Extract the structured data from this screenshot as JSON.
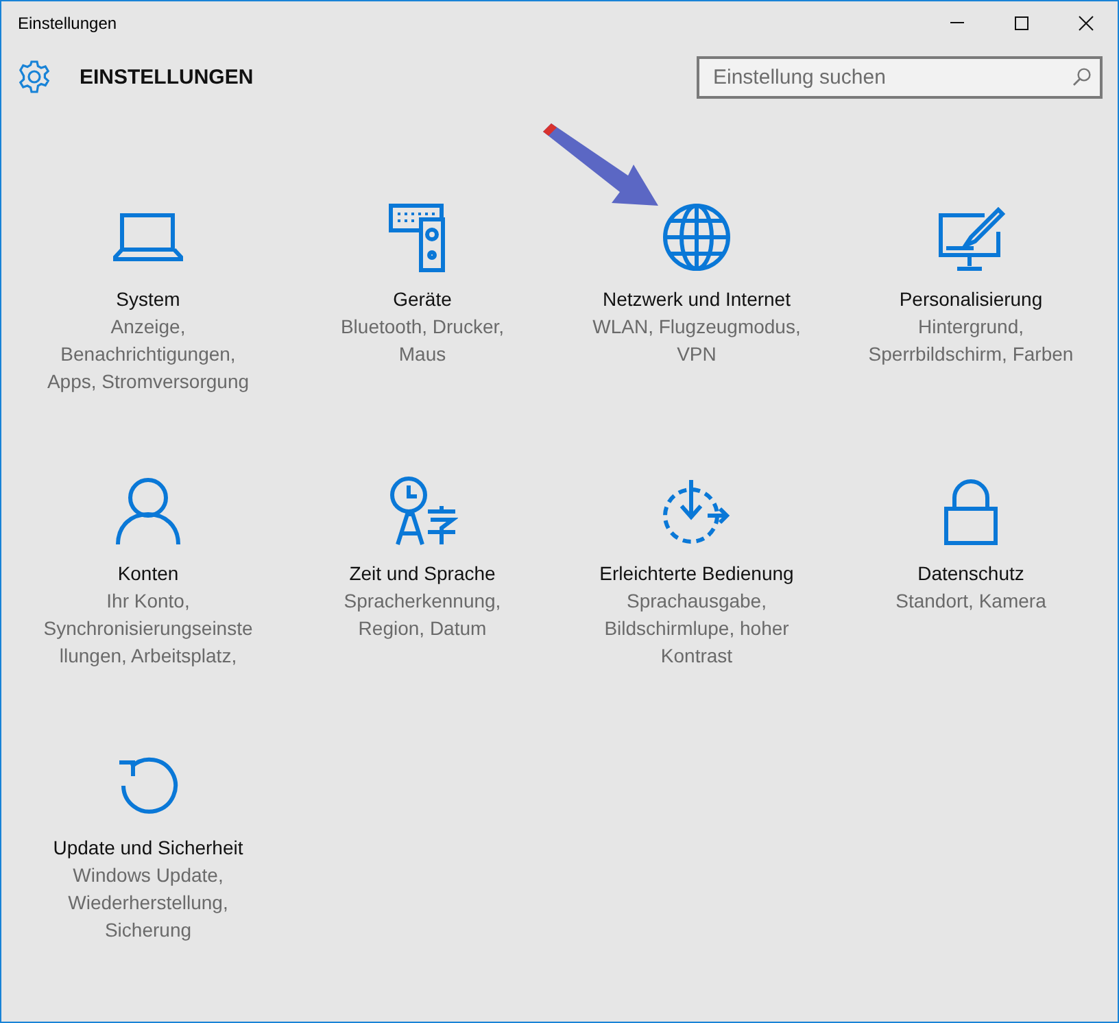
{
  "window": {
    "title": "Einstellungen"
  },
  "header": {
    "title": "EINSTELLUNGEN"
  },
  "search": {
    "placeholder": "Einstellung suchen"
  },
  "tiles": [
    {
      "title": "System",
      "lines": [
        "Anzeige,",
        "Benachrichtigungen,",
        "Apps, Stromversorgung"
      ]
    },
    {
      "title": "Geräte",
      "lines": [
        "Bluetooth, Drucker,",
        "Maus"
      ]
    },
    {
      "title": "Netzwerk und Internet",
      "lines": [
        "WLAN, Flugzeugmodus,",
        "VPN"
      ]
    },
    {
      "title": "Personalisierung",
      "lines": [
        "Hintergrund,",
        "Sperrbildschirm, Farben"
      ]
    },
    {
      "title": "Konten",
      "lines": [
        "Ihr Konto,",
        "Synchronisierungseinste",
        "llungen, Arbeitsplatz,"
      ]
    },
    {
      "title": "Zeit und Sprache",
      "lines": [
        "Spracherkennung,",
        "Region, Datum"
      ]
    },
    {
      "title": "Erleichterte Bedienung",
      "lines": [
        "Sprachausgabe,",
        "Bildschirmlupe, hoher",
        "Kontrast"
      ]
    },
    {
      "title": "Datenschutz",
      "lines": [
        "Standort, Kamera"
      ]
    },
    {
      "title": "Update und Sicherheit",
      "lines": [
        "Windows Update,",
        "Wiederherstellung,",
        "Sicherung"
      ]
    }
  ]
}
